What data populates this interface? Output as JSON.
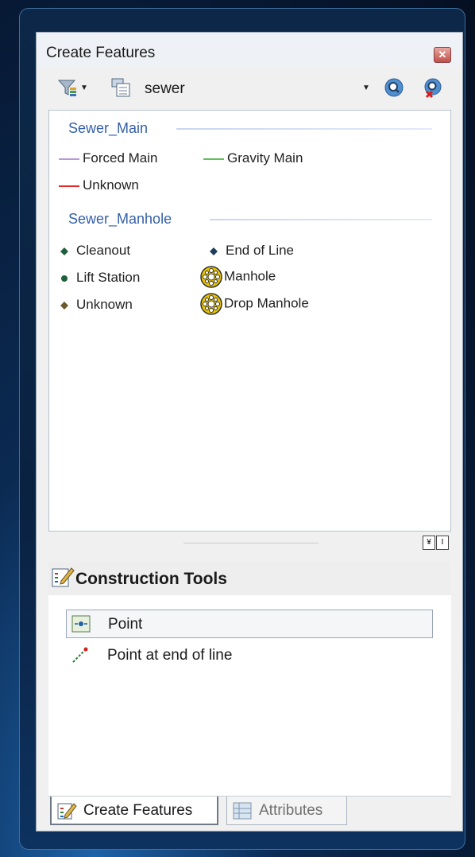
{
  "window": {
    "title": "Create Features",
    "close_glyph": "✕"
  },
  "toolbar": {
    "filter_icon": "template-filter-icon",
    "layer_icon": "layer-list-icon",
    "layer_name": "sewer",
    "search_icon": "search-icon",
    "clear_search_icon": "clear-search-icon"
  },
  "templates": {
    "groups": [
      {
        "name": "Sewer_Main",
        "items": [
          {
            "label": "Forced Main",
            "symbol": "line",
            "color": "#b799d8"
          },
          {
            "label": "Gravity Main",
            "symbol": "line",
            "color": "#5fbf5a"
          },
          {
            "label": "Unknown",
            "symbol": "line",
            "color": "#e5282a"
          }
        ]
      },
      {
        "name": "Sewer_Manhole",
        "items": [
          {
            "label": "Cleanout",
            "symbol": "point",
            "color": "#1f5f3a"
          },
          {
            "label": "End of Line",
            "symbol": "point",
            "color": "#1f3d5c"
          },
          {
            "label": "Lift Station",
            "symbol": "point",
            "color": "#1f5f3a"
          },
          {
            "label": "Manhole",
            "symbol": "manhole",
            "color": "#e8c400"
          },
          {
            "label": "Unknown",
            "symbol": "point",
            "color": "#6b5a2a"
          },
          {
            "label": "Drop Manhole",
            "symbol": "manhole",
            "color": "#e8c400"
          }
        ]
      }
    ]
  },
  "splitter": {
    "collapse_glyph": "¥",
    "restore_glyph": "I"
  },
  "construction_tools": {
    "title": "Construction Tools",
    "tools": [
      {
        "label": "Point",
        "selected": true
      },
      {
        "label": "Point at end of line",
        "selected": false
      }
    ]
  },
  "tabs": [
    {
      "label": "Create Features",
      "active": true
    },
    {
      "label": "Attributes",
      "active": false
    }
  ]
}
